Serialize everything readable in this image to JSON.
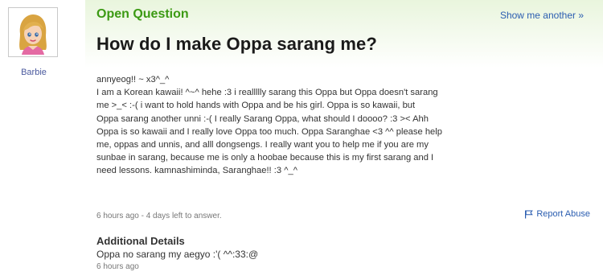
{
  "user": {
    "name": "Barbie",
    "avatar_icon": "barbie-avatar-icon"
  },
  "header": {
    "label": "Open Question",
    "show_another": "Show me another »"
  },
  "question": {
    "title": "How do I make Oppa sarang me?",
    "body": "annyeog!! ~ x3^_^\nI am a Korean kawaii! ^~^ hehe :3 i reallllly sarang this Oppa but Oppa doesn't sarang\nme >_< :-( i want to hold hands with Oppa and be his girl. Oppa is so kawaii, but\nOppa sarang another unni :-( I really Sarang Oppa, what should I doooo? :3 >< Ahh\nOppa is so kawaii and I really love Oppa too much. Oppa Saranghae <3 ^^ please help\nme, oppas and unnis, and alll dongsengs. I really want you to help me if you are my\nsunbae in sarang, because me is only a hoobae because this is my first sarang and I\nneed lessons. kamnashiminda, Saranghae!! :3 ^_^",
    "meta": "6 hours ago - 4 days left to answer.",
    "report_abuse": "Report Abuse"
  },
  "additional": {
    "title": "Additional Details",
    "text": "Oppa no sarang my aegyo :'( ^^:33:@",
    "meta": "6 hours ago"
  },
  "colors": {
    "accent_green": "#3c9a14",
    "link_blue": "#2a5db0"
  }
}
